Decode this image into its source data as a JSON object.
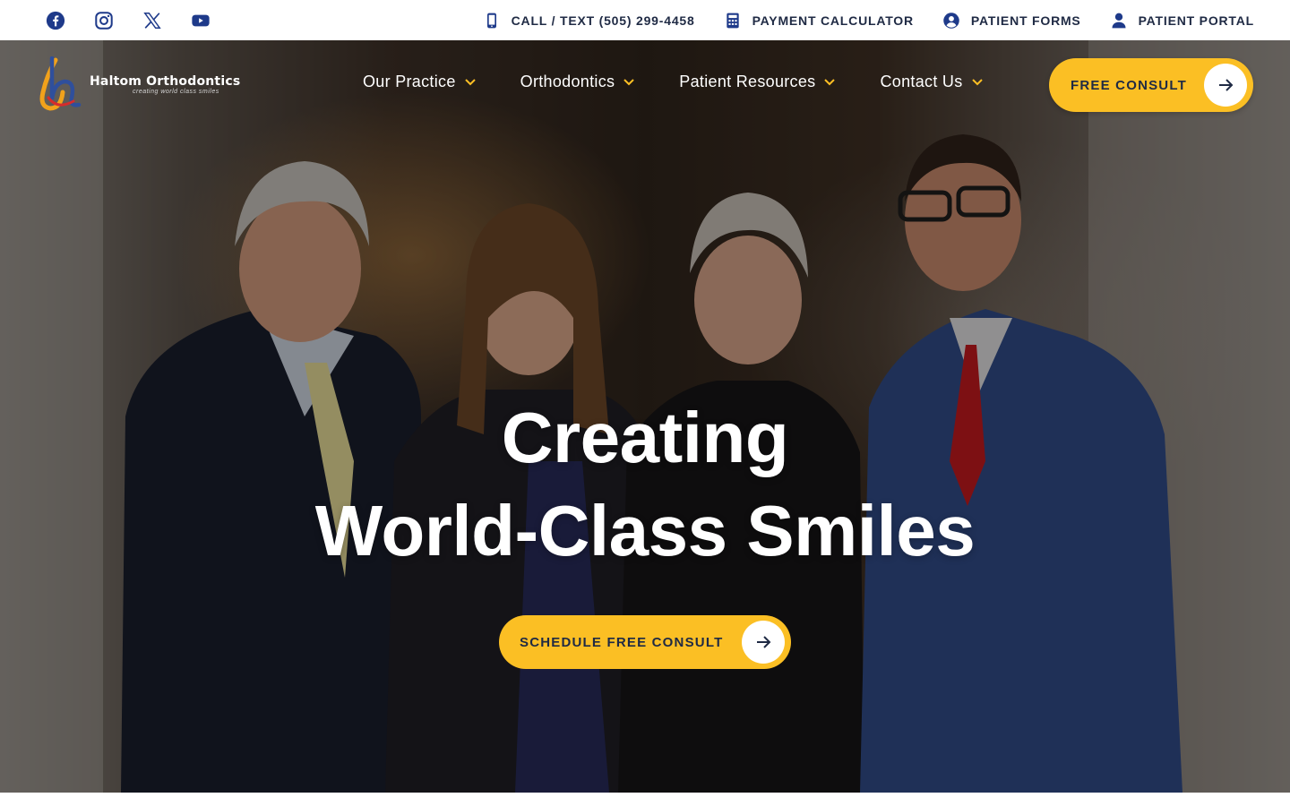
{
  "topbar": {
    "socials": [
      {
        "icon": "facebook-icon"
      },
      {
        "icon": "instagram-icon"
      },
      {
        "icon": "x-twitter-icon"
      },
      {
        "icon": "youtube-icon"
      }
    ],
    "links": [
      {
        "icon": "phone-icon",
        "label": "CALL / TEXT (505) 299-4458"
      },
      {
        "icon": "calculator-icon",
        "label": "PAYMENT CALCULATOR"
      },
      {
        "icon": "user-circle-icon",
        "label": "PATIENT FORMS"
      },
      {
        "icon": "user-icon",
        "label": "PATIENT PORTAL"
      }
    ]
  },
  "header": {
    "logo": {
      "name": "Haltom Orthodontics",
      "tagline": "creating world class smiles"
    },
    "menu": [
      {
        "label": "Our Practice"
      },
      {
        "label": "Orthodontics"
      },
      {
        "label": "Patient Resources"
      },
      {
        "label": "Contact Us"
      }
    ],
    "cta": {
      "label": "FREE CONSULT"
    }
  },
  "hero": {
    "headline_line1": "Creating",
    "headline_line2": "World-Class Smiles",
    "cta": {
      "label": "SCHEDULE FREE CONSULT"
    }
  },
  "colors": {
    "accent": "#fbbf24",
    "navy": "#1f2a44",
    "icon_blue": "#1e3a8a",
    "white": "#ffffff"
  }
}
